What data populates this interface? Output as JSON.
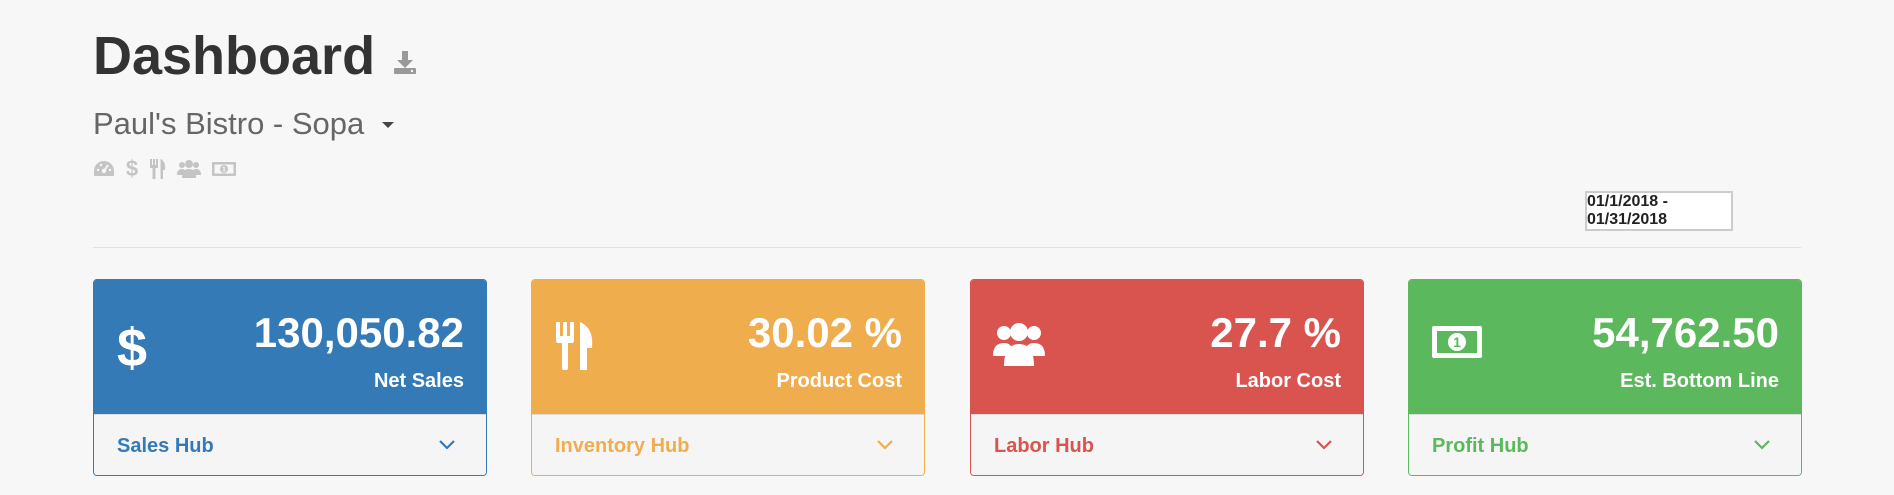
{
  "header": {
    "title": "Dashboard",
    "download_icon": "download-icon",
    "location": "Paul's Bistro - Sopa",
    "mini_icons": [
      "dashboard-icon",
      "dollar-icon",
      "utensils-icon",
      "users-icon",
      "money-icon"
    ]
  },
  "date_range": "01/1/2018 - 01/31/2018",
  "colors": {
    "blue": "#337ab7",
    "orange": "#f0ad4e",
    "red": "#d9534f",
    "green": "#5cb85c",
    "background": "#f7f7f7"
  },
  "cards": [
    {
      "value": "130,050.82",
      "label": "Net Sales",
      "hub": "Sales Hub",
      "icon": "dollar-icon"
    },
    {
      "value": "30.02 %",
      "label": "Product Cost",
      "hub": "Inventory Hub",
      "icon": "utensils-icon"
    },
    {
      "value": "27.7 %",
      "label": "Labor Cost",
      "hub": "Labor Hub",
      "icon": "users-icon"
    },
    {
      "value": "54,762.50",
      "label": "Est. Bottom Line",
      "hub": "Profit Hub",
      "icon": "money-icon"
    }
  ]
}
